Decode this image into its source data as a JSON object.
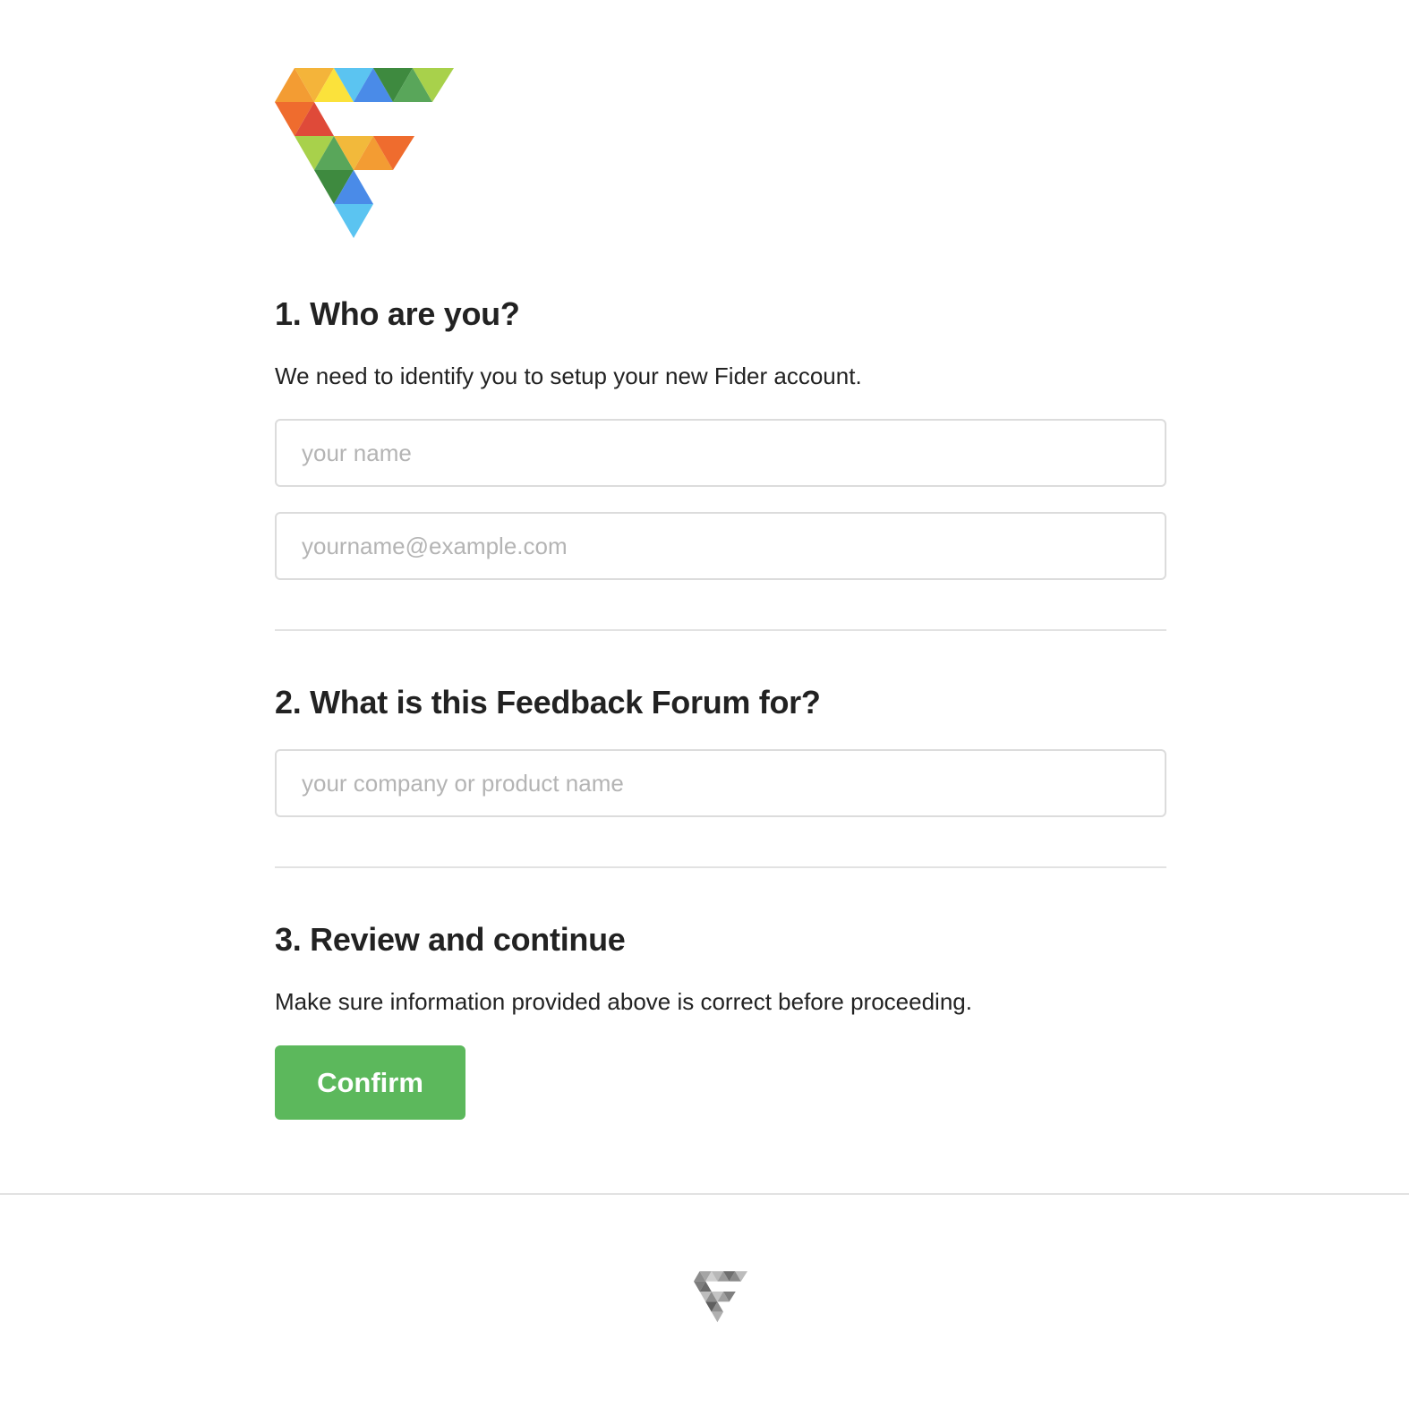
{
  "logo": {
    "icon": "fider-logo-icon",
    "colors": [
      "#f39c33",
      "#fbe23b",
      "#5bc4f1",
      "#4a8be8",
      "#3e8a3f",
      "#59a65a",
      "#a8d14b",
      "#ef6c2e",
      "#df4a39",
      "#f2b93b"
    ]
  },
  "section1": {
    "title": "1. Who are you?",
    "description": "We need to identify you to setup your new Fider account.",
    "name_field": {
      "value": "",
      "placeholder": "your name"
    },
    "email_field": {
      "value": "",
      "placeholder": "yourname@example.com"
    }
  },
  "section2": {
    "title": "2. What is this Feedback Forum for?",
    "product_field": {
      "value": "",
      "placeholder": "your company or product name"
    }
  },
  "section3": {
    "title": "3. Review and continue",
    "description": "Make sure information provided above is correct before proceeding.",
    "confirm_label": "Confirm"
  },
  "footer": {
    "icon": "fider-footer-logo-icon"
  },
  "colors": {
    "confirm_button": "#5cb85c",
    "heading_text": "#222222",
    "placeholder_text": "#b4b4b4",
    "border": "#dcdcdc"
  }
}
